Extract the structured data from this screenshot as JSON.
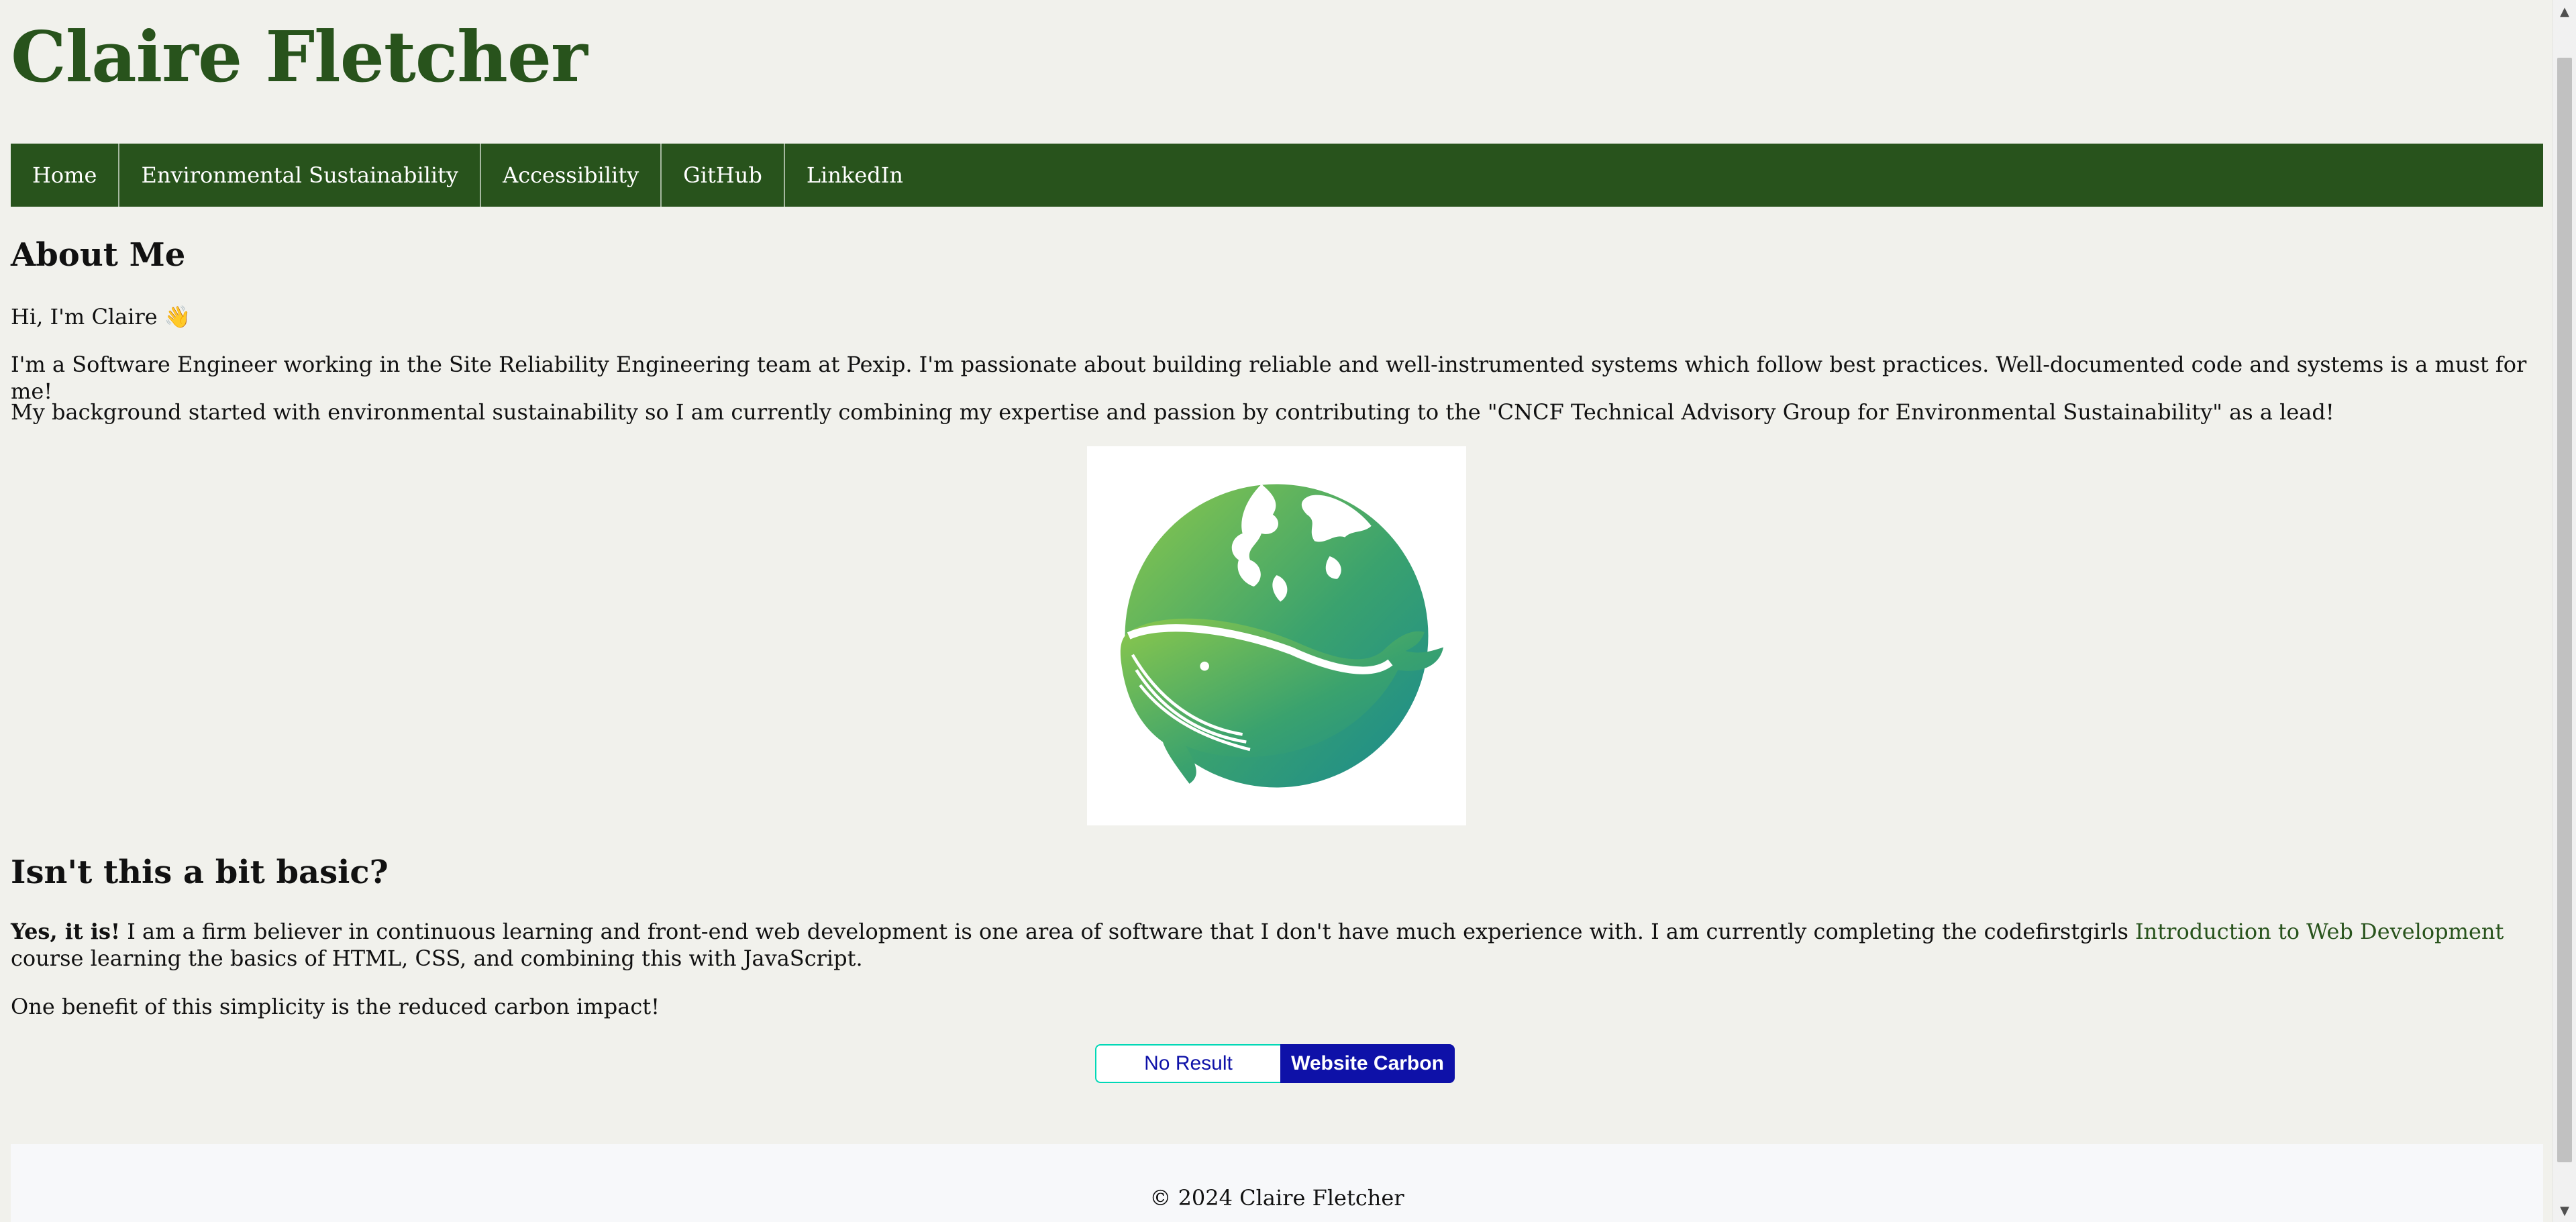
{
  "site": {
    "title": "Claire Fletcher"
  },
  "nav": {
    "items": [
      {
        "label": "Home"
      },
      {
        "label": "Environmental Sustainability"
      },
      {
        "label": "Accessibility"
      },
      {
        "label": "GitHub"
      },
      {
        "label": "LinkedIn"
      }
    ]
  },
  "about": {
    "heading": "About Me",
    "greeting": "Hi, I'm Claire 👋",
    "paragraph1": "I'm a Software Engineer working in the Site Reliability Engineering team at Pexip. I'm passionate about building reliable and well-instrumented systems which follow best practices. Well-documented code and systems is a must for me!",
    "paragraph2": "My background started with environmental sustainability so I am currently combining my expertise and passion by contributing to the \"CNCF Technical Advisory Group for Environmental Sustainability\" as a lead!"
  },
  "hero_image": {
    "icon": "globe-whale-icon"
  },
  "basic": {
    "heading": "Isn't this a bit basic?",
    "bold_lead": "Yes, it is!",
    "text_before_link": " I am a firm believer in continuous learning and front-end web development is one area of software that I don't have much experience with. I am currently completing the codefirstgirls ",
    "link_text": "Introduction to Web Development",
    "text_after_link": " course learning the basics of HTML, CSS, and combining this with JavaScript.",
    "benefit": "One benefit of this simplicity is the reduced carbon impact!"
  },
  "carbon_badge": {
    "result": "No Result",
    "link_label": "Website Carbon",
    "colors": {
      "accent": "#0e11a8",
      "border": "#00d8b6"
    }
  },
  "footer": {
    "text": "© 2024 Claire Fletcher"
  },
  "colors": {
    "brand_green": "#28531c",
    "page_background": "#f1f1ec"
  }
}
